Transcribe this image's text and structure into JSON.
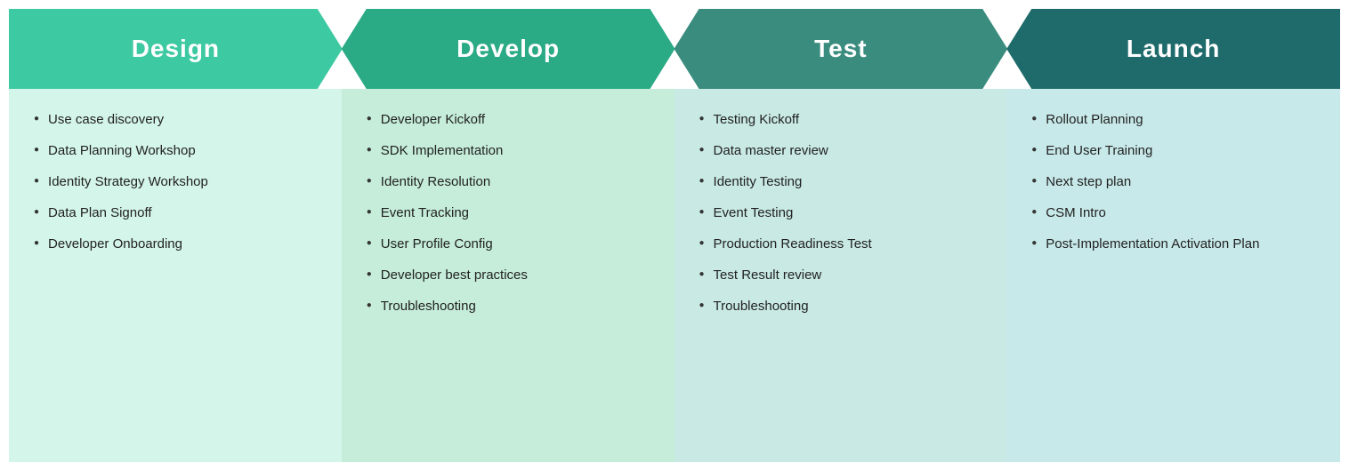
{
  "phases": [
    {
      "id": "design",
      "label": "Design",
      "items": [
        "Use case discovery",
        "Data Planning Workshop",
        "Identity Strategy Workshop",
        "Data Plan Signoff",
        "Developer Onboarding"
      ]
    },
    {
      "id": "develop",
      "label": "Develop",
      "items": [
        "Developer Kickoff",
        "SDK  Implementation",
        "Identity Resolution",
        "Event Tracking",
        "User Profile Config",
        "Developer best practices",
        "Troubleshooting"
      ]
    },
    {
      "id": "test",
      "label": "Test",
      "items": [
        "Testing Kickoff",
        "Data master review",
        "Identity Testing",
        "Event Testing",
        "Production Readiness Test",
        "Test Result review",
        "Troubleshooting"
      ]
    },
    {
      "id": "launch",
      "label": "Launch",
      "items": [
        "Rollout Planning",
        "End User Training",
        "Next step plan",
        "CSM Intro",
        "Post-Implementation Activation Plan"
      ]
    }
  ]
}
